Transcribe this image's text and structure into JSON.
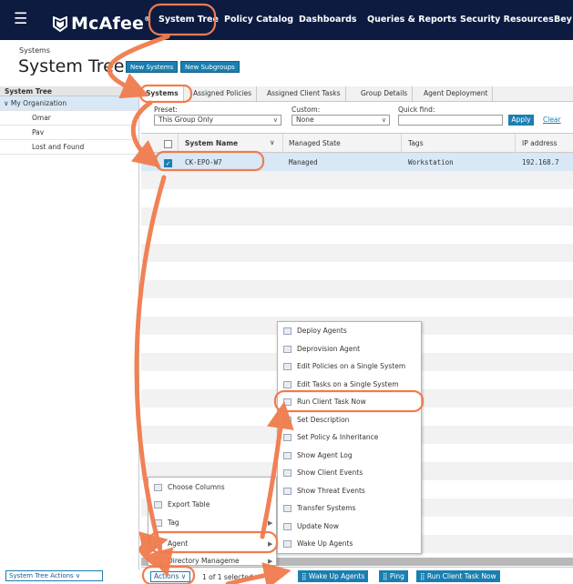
{
  "nav": {
    "brand": "McAfee",
    "items": [
      "System Tree",
      "Policy Catalog",
      "Dashboards",
      "Queries & Reports",
      "Security Resources",
      "Bey"
    ]
  },
  "header": {
    "breadcrumb": "Systems",
    "title": "System Tree",
    "new_systems": "New Systems",
    "new_subgroups": "New Subgroups"
  },
  "sidebar": {
    "header": "System Tree",
    "root": "My Organization",
    "items": [
      "Omar",
      "Pav",
      "Lost and Found"
    ],
    "actions_button": "System Tree Actions"
  },
  "tabs": [
    "Systems",
    "Assigned Policies",
    "Assigned Client Tasks",
    "Group Details",
    "Agent Deployment"
  ],
  "filters": {
    "preset_label": "Preset:",
    "preset_value": "This Group Only",
    "custom_label": "Custom:",
    "custom_value": "None",
    "quick_find_label": "Quick find:",
    "apply": "Apply",
    "clear": "Clear"
  },
  "table": {
    "columns": [
      "System Name",
      "Managed State",
      "Tags",
      "IP address"
    ],
    "rows": [
      {
        "system_name": "CK-EPO-W7",
        "managed_state": "Managed",
        "tags": "Workstation",
        "ip": "192.168.7"
      }
    ]
  },
  "actions_menu": {
    "items": [
      "Choose Columns",
      "Export Table",
      "Tag",
      "Agent",
      "Directory Manageme"
    ]
  },
  "agent_submenu": {
    "items": [
      "Deploy Agents",
      "Deprovision Agent",
      "Edit Policies on a Single System",
      "Edit Tasks on a Single System",
      "Run Client Task Now",
      "Set Description",
      "Set Policy & Inheritance",
      "Show Agent Log",
      "Show Client Events",
      "Show Threat Events",
      "Transfer Systems",
      "Update Now",
      "Wake Up Agents"
    ]
  },
  "bottom_bar": {
    "actions": "Actions",
    "selected_text": "1 of 1 selected",
    "wake_up": "Wake Up Agents",
    "ping": "Ping",
    "run_task": "Run Client Task Now"
  },
  "colors": {
    "nav_bg": "#0d1b40",
    "accent": "#1a7fb0",
    "annotation": "#f07c4e",
    "selection": "#d8e8f6"
  }
}
